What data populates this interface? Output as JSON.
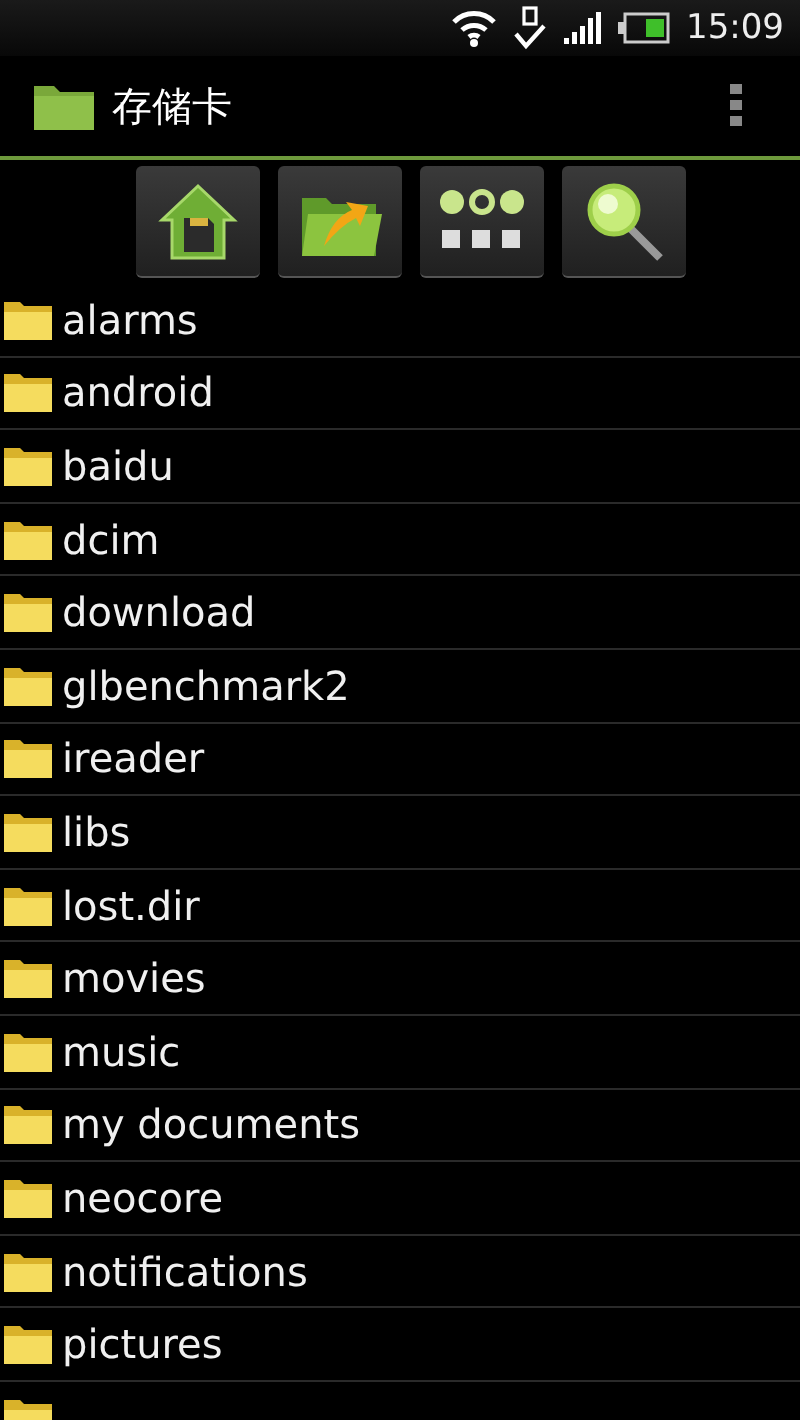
{
  "status_bar": {
    "time": "15:09"
  },
  "title_bar": {
    "title": "存储卡"
  },
  "toolbar": [
    {
      "kind": "home"
    },
    {
      "kind": "up"
    },
    {
      "kind": "select"
    },
    {
      "kind": "search"
    }
  ],
  "files": [
    {
      "name": "alarms"
    },
    {
      "name": "android"
    },
    {
      "name": "baidu"
    },
    {
      "name": "dcim"
    },
    {
      "name": "download"
    },
    {
      "name": "glbenchmark2"
    },
    {
      "name": "ireader"
    },
    {
      "name": "libs"
    },
    {
      "name": "lost.dir"
    },
    {
      "name": "movies"
    },
    {
      "name": "music"
    },
    {
      "name": "my documents"
    },
    {
      "name": "neocore"
    },
    {
      "name": "notifications"
    },
    {
      "name": "pictures"
    }
  ]
}
